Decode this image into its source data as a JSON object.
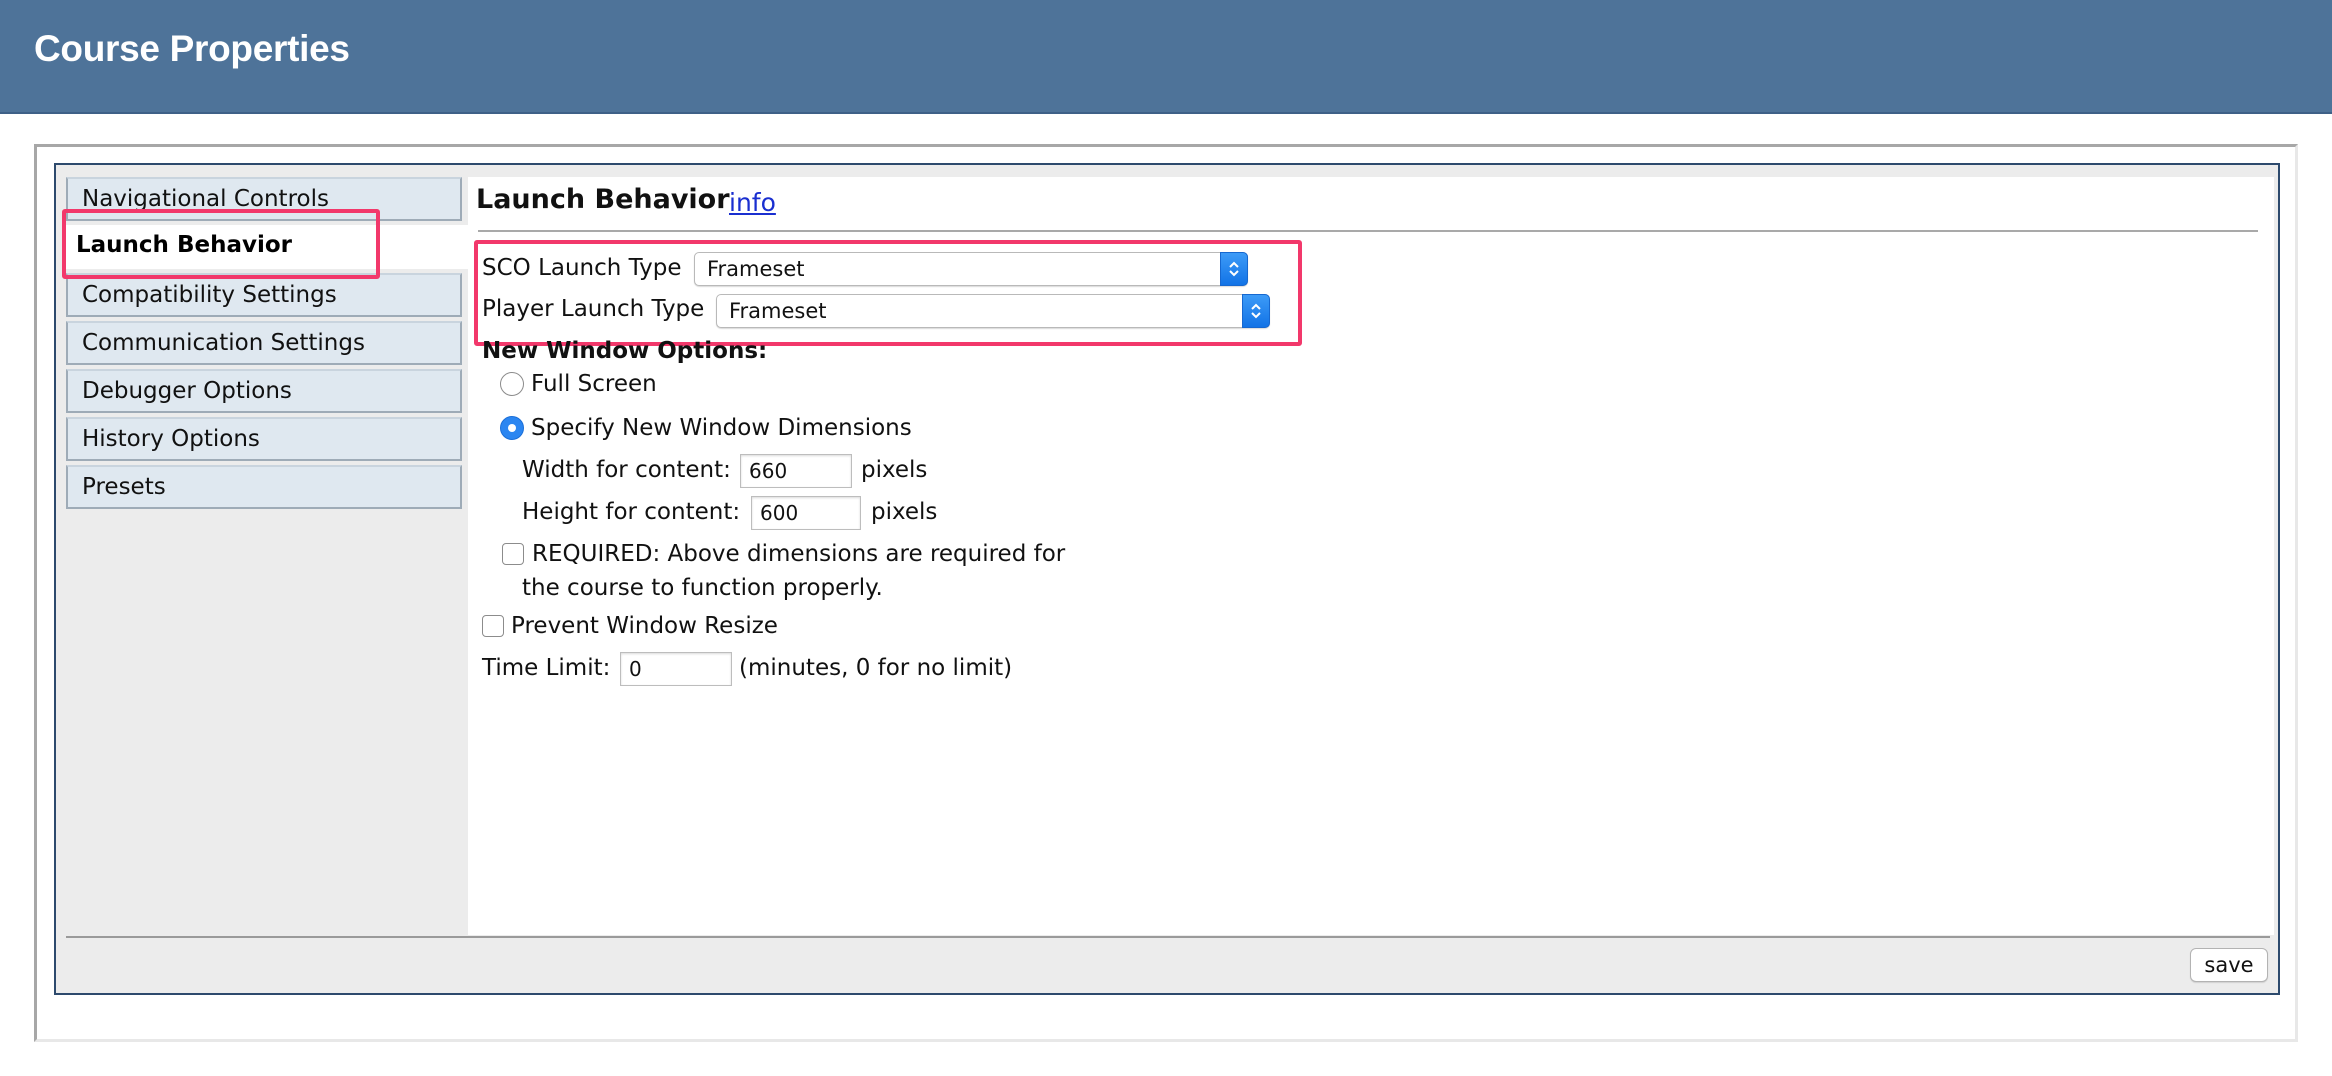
{
  "header": {
    "title": "Course Properties"
  },
  "sidebar": {
    "items": [
      {
        "label": "Navigational Controls"
      },
      {
        "label": "Launch Behavior"
      },
      {
        "label": "Compatibility Settings"
      },
      {
        "label": "Communication Settings"
      },
      {
        "label": "Debugger Options"
      },
      {
        "label": "History Options"
      },
      {
        "label": "Presets"
      }
    ],
    "active_index": 1
  },
  "main": {
    "section_title": "Launch Behavior",
    "info_link": "info",
    "sco_launch_type": {
      "label": "SCO Launch Type",
      "value": "Frameset"
    },
    "player_launch_type": {
      "label": "Player Launch Type",
      "value": "Frameset"
    },
    "new_window_options": {
      "heading": "New Window Options:",
      "full_screen": {
        "label": "Full Screen",
        "checked": false
      },
      "specify_dimensions": {
        "label": "Specify New Window Dimensions",
        "checked": true
      },
      "width": {
        "label": "Width for content:",
        "value": "660",
        "unit": "pixels"
      },
      "height": {
        "label": "Height for content:",
        "value": "600",
        "unit": "pixels"
      },
      "required": {
        "line1": "REQUIRED: Above dimensions are required for",
        "line2": "the course to function properly.",
        "checked": false
      }
    },
    "prevent_resize": {
      "label": "Prevent Window Resize",
      "checked": false
    },
    "time_limit": {
      "label": "Time Limit:",
      "value": "0",
      "note": "(minutes, 0 for no limit)"
    }
  },
  "footer": {
    "save_label": "save"
  },
  "colors": {
    "header_bg": "#4e7399",
    "highlight": "#f2386b",
    "link": "#1a2fd0",
    "select_accent": "#1f7ef0"
  },
  "icons": {
    "select_arrow": "chevron-updown-icon",
    "radio": "radio-icon",
    "checkbox": "checkbox-icon"
  }
}
